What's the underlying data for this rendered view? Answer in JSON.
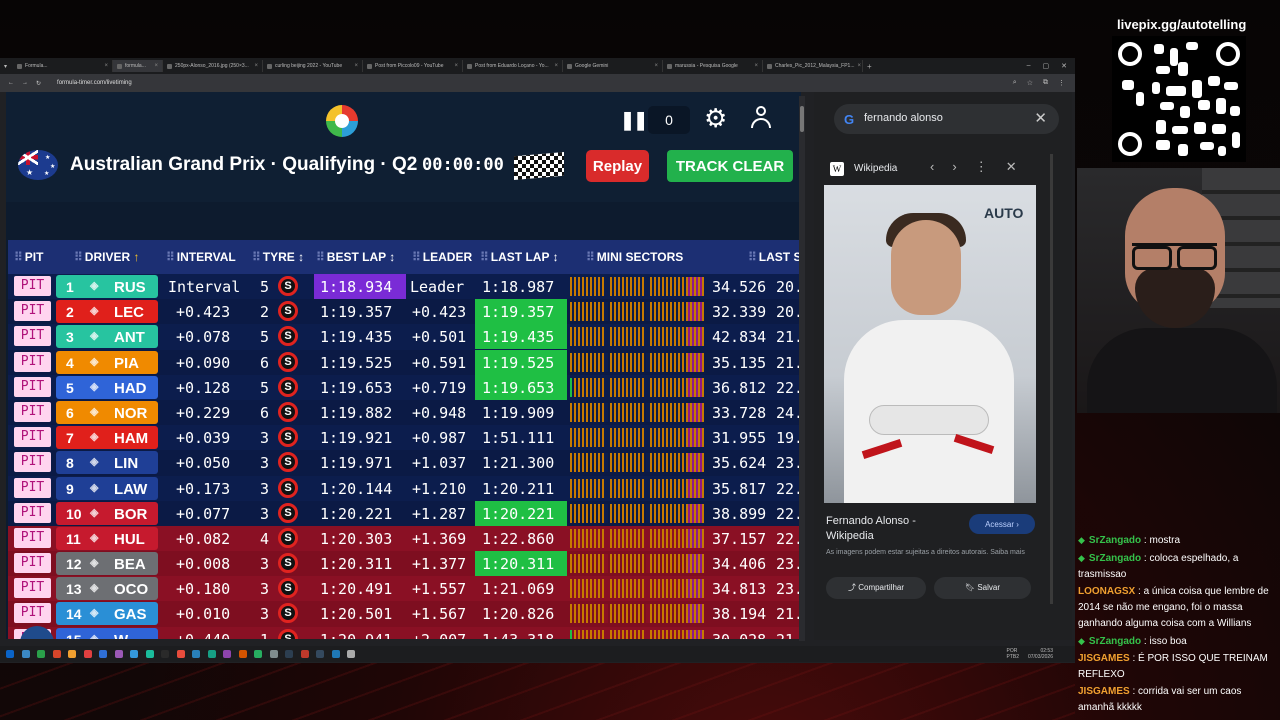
{
  "browser": {
    "tabs": [
      {
        "label": "Formula...",
        "active": false
      },
      {
        "label": "formula...",
        "active": true
      },
      {
        "label": "250px-Alonso_2016.jpg (250×3...",
        "active": false
      },
      {
        "label": "curling beijing 2022 - YouTube",
        "active": false
      },
      {
        "label": "Post from Piccolo09 - YouTube",
        "active": false
      },
      {
        "label": "Post from Eduardo Loçano - Yo...",
        "active": false
      },
      {
        "label": "Google Gemini",
        "active": false
      },
      {
        "label": "marussia - Pesquisa Google",
        "active": false
      },
      {
        "label": "Charles_Pic_2012_Malaysia_FP1...",
        "active": false
      }
    ],
    "url": "formula-timer.com/livetiming"
  },
  "page": {
    "counter": "0",
    "race_title": "Australian Grand Prix · Qualifying · Q2",
    "clock": "00:00:00",
    "replay_label": "Replay",
    "track_clear_label": "TRACK CLEAR"
  },
  "table": {
    "headers": {
      "pit": "PIT",
      "driver": "DRIVER",
      "driver_arrow": "↑",
      "interval": "INTERVAL",
      "tyre": "TYRE",
      "tyre_arrow": "↕",
      "best_lap": "BEST LAP",
      "best_arrow": "↕",
      "leader": "LEADER",
      "last_lap": "LAST LAP",
      "last_arrow": "↕",
      "mini_sectors": "MINI SECTORS",
      "last_s": "LAST S"
    },
    "rows": [
      {
        "pit": "PIT",
        "pos": "1",
        "code": "RUS",
        "team_color": "#27c4a0",
        "interval": "Interval",
        "tyre_laps": "5",
        "tyre": "S",
        "best": "1:18.934",
        "best_purple": true,
        "leader": "Leader",
        "last": "1:18.987",
        "last_green": false,
        "s1": "34.526",
        "s2": "20.",
        "zone": "blue"
      },
      {
        "pit": "PIT",
        "pos": "2",
        "code": "LEC",
        "team_color": "#e0201b",
        "interval": "+0.423",
        "tyre_laps": "2",
        "tyre": "S",
        "best": "1:19.357",
        "best_purple": false,
        "leader": "+0.423",
        "last": "1:19.357",
        "last_green": true,
        "s1": "32.339",
        "s2": "20.",
        "zone": "blue"
      },
      {
        "pit": "PIT",
        "pos": "3",
        "code": "ANT",
        "team_color": "#27c4a0",
        "interval": "+0.078",
        "tyre_laps": "5",
        "tyre": "S",
        "best": "1:19.435",
        "best_purple": false,
        "leader": "+0.501",
        "last": "1:19.435",
        "last_green": true,
        "s1": "42.834",
        "s2": "21.",
        "zone": "blue"
      },
      {
        "pit": "PIT",
        "pos": "4",
        "code": "PIA",
        "team_color": "#f08a00",
        "interval": "+0.090",
        "tyre_laps": "6",
        "tyre": "S",
        "best": "1:19.525",
        "best_purple": false,
        "leader": "+0.591",
        "last": "1:19.525",
        "last_green": true,
        "s1": "35.135",
        "s2": "21.",
        "zone": "blue"
      },
      {
        "pit": "PIT",
        "pos": "5",
        "code": "HAD",
        "team_color": "#2f64d8",
        "interval": "+0.128",
        "tyre_laps": "5",
        "tyre": "S",
        "best": "1:19.653",
        "best_purple": false,
        "leader": "+0.719",
        "last": "1:19.653",
        "last_green": true,
        "s1": "36.812",
        "s2": "22.",
        "zone": "blue"
      },
      {
        "pit": "PIT",
        "pos": "6",
        "code": "NOR",
        "team_color": "#f08a00",
        "interval": "+0.229",
        "tyre_laps": "6",
        "tyre": "S",
        "best": "1:19.882",
        "best_purple": false,
        "leader": "+0.948",
        "last": "1:19.909",
        "last_green": false,
        "s1": "33.728",
        "s2": "24.",
        "zone": "blue"
      },
      {
        "pit": "PIT",
        "pos": "7",
        "code": "HAM",
        "team_color": "#e0201b",
        "interval": "+0.039",
        "tyre_laps": "3",
        "tyre": "S",
        "best": "1:19.921",
        "best_purple": false,
        "leader": "+0.987",
        "last": "1:51.111",
        "last_green": false,
        "s1": "31.955",
        "s2": "19.",
        "zone": "blue"
      },
      {
        "pit": "PIT",
        "pos": "8",
        "code": "LIN",
        "team_color": "#1f3f96",
        "interval": "+0.050",
        "tyre_laps": "3",
        "tyre": "S",
        "best": "1:19.971",
        "best_purple": false,
        "leader": "+1.037",
        "last": "1:21.300",
        "last_green": false,
        "s1": "35.624",
        "s2": "23.",
        "zone": "blue"
      },
      {
        "pit": "PIT",
        "pos": "9",
        "code": "LAW",
        "team_color": "#1f3f96",
        "interval": "+0.173",
        "tyre_laps": "3",
        "tyre": "S",
        "best": "1:20.144",
        "best_purple": false,
        "leader": "+1.210",
        "last": "1:20.211",
        "last_green": false,
        "s1": "35.817",
        "s2": "22.",
        "zone": "blue"
      },
      {
        "pit": "PIT",
        "pos": "10",
        "code": "BOR",
        "team_color": "#c61a2e",
        "interval": "+0.077",
        "tyre_laps": "3",
        "tyre": "S",
        "best": "1:20.221",
        "best_purple": false,
        "leader": "+1.287",
        "last": "1:20.221",
        "last_green": true,
        "s1": "38.899",
        "s2": "22.",
        "zone": "blue"
      },
      {
        "pit": "PIT",
        "pos": "11",
        "code": "HUL",
        "team_color": "#c61a2e",
        "interval": "+0.082",
        "tyre_laps": "4",
        "tyre": "S",
        "best": "1:20.303",
        "best_purple": false,
        "leader": "+1.369",
        "last": "1:22.860",
        "last_green": false,
        "s1": "37.157",
        "s2": "22.",
        "zone": "red"
      },
      {
        "pit": "PIT",
        "pos": "12",
        "code": "BEA",
        "team_color": "#6d6f73",
        "interval": "+0.008",
        "tyre_laps": "3",
        "tyre": "S",
        "best": "1:20.311",
        "best_purple": false,
        "leader": "+1.377",
        "last": "1:20.311",
        "last_green": true,
        "s1": "34.406",
        "s2": "23.",
        "zone": "red"
      },
      {
        "pit": "PIT",
        "pos": "13",
        "code": "OCO",
        "team_color": "#6d6f73",
        "interval": "+0.180",
        "tyre_laps": "3",
        "tyre": "S",
        "best": "1:20.491",
        "best_purple": false,
        "leader": "+1.557",
        "last": "1:21.069",
        "last_green": false,
        "s1": "34.813",
        "s2": "23.",
        "zone": "red"
      },
      {
        "pit": "PIT",
        "pos": "14",
        "code": "GAS",
        "team_color": "#2a8fd6",
        "interval": "+0.010",
        "tyre_laps": "3",
        "tyre": "S",
        "best": "1:20.501",
        "best_purple": false,
        "leader": "+1.567",
        "last": "1:20.826",
        "last_green": false,
        "s1": "38.194",
        "s2": "21.",
        "zone": "red"
      },
      {
        "pit": "PIT",
        "pos": "15",
        "code": "W ALB",
        "team_color": "#2f64d8",
        "interval": "+0.440",
        "tyre_laps": "1",
        "tyre": "S",
        "best": "1:20.941",
        "best_purple": false,
        "leader": "+2.007",
        "last": "1:43.318",
        "last_green": false,
        "s1": "30.028",
        "s2": "21.",
        "zone": "red"
      }
    ]
  },
  "panel": {
    "search_query": "fernando alonso",
    "source": "Wikipedia",
    "photo_brand": "AUTO",
    "caption": "Fernando Alonso - Wikipedia",
    "acessar": "Acessar ›",
    "disclaimer": "As imagens podem estar sujeitas a direitos autorais. Saiba mais",
    "compartilhar": "Compartilhar",
    "salvar": "Salvar"
  },
  "overlay": {
    "livepix": "livepix.gg/autotelling",
    "chat": [
      {
        "user": "SrZangado",
        "text": "mostra",
        "color": "#35c24b",
        "badge": true
      },
      {
        "user": "SrZangado",
        "text": "coloca espelhado, a trasmissao",
        "color": "#35c24b",
        "badge": true
      },
      {
        "user": "LOONAGSX",
        "text": "a única coisa que lembre de 2014 se não me engano, foi o massa ganhando alguma coisa com a Willians",
        "color": "#f0a030",
        "badge": false
      },
      {
        "user": "SrZangado",
        "text": "isso boa",
        "color": "#35c24b",
        "badge": true
      },
      {
        "user": "JISGAMES",
        "text": "É POR ISSO QUE TREINAM REFLEXO",
        "color": "#f0a030",
        "badge": false
      },
      {
        "user": "JISGAMES",
        "text": "corrida vai ser um caos amanhã kkkkk",
        "color": "#f0a030",
        "badge": false
      }
    ]
  },
  "taskbar": {
    "lang_top": "POR",
    "lang_bottom": "PTB2",
    "time": "02:53",
    "date": "07/03/2026"
  }
}
